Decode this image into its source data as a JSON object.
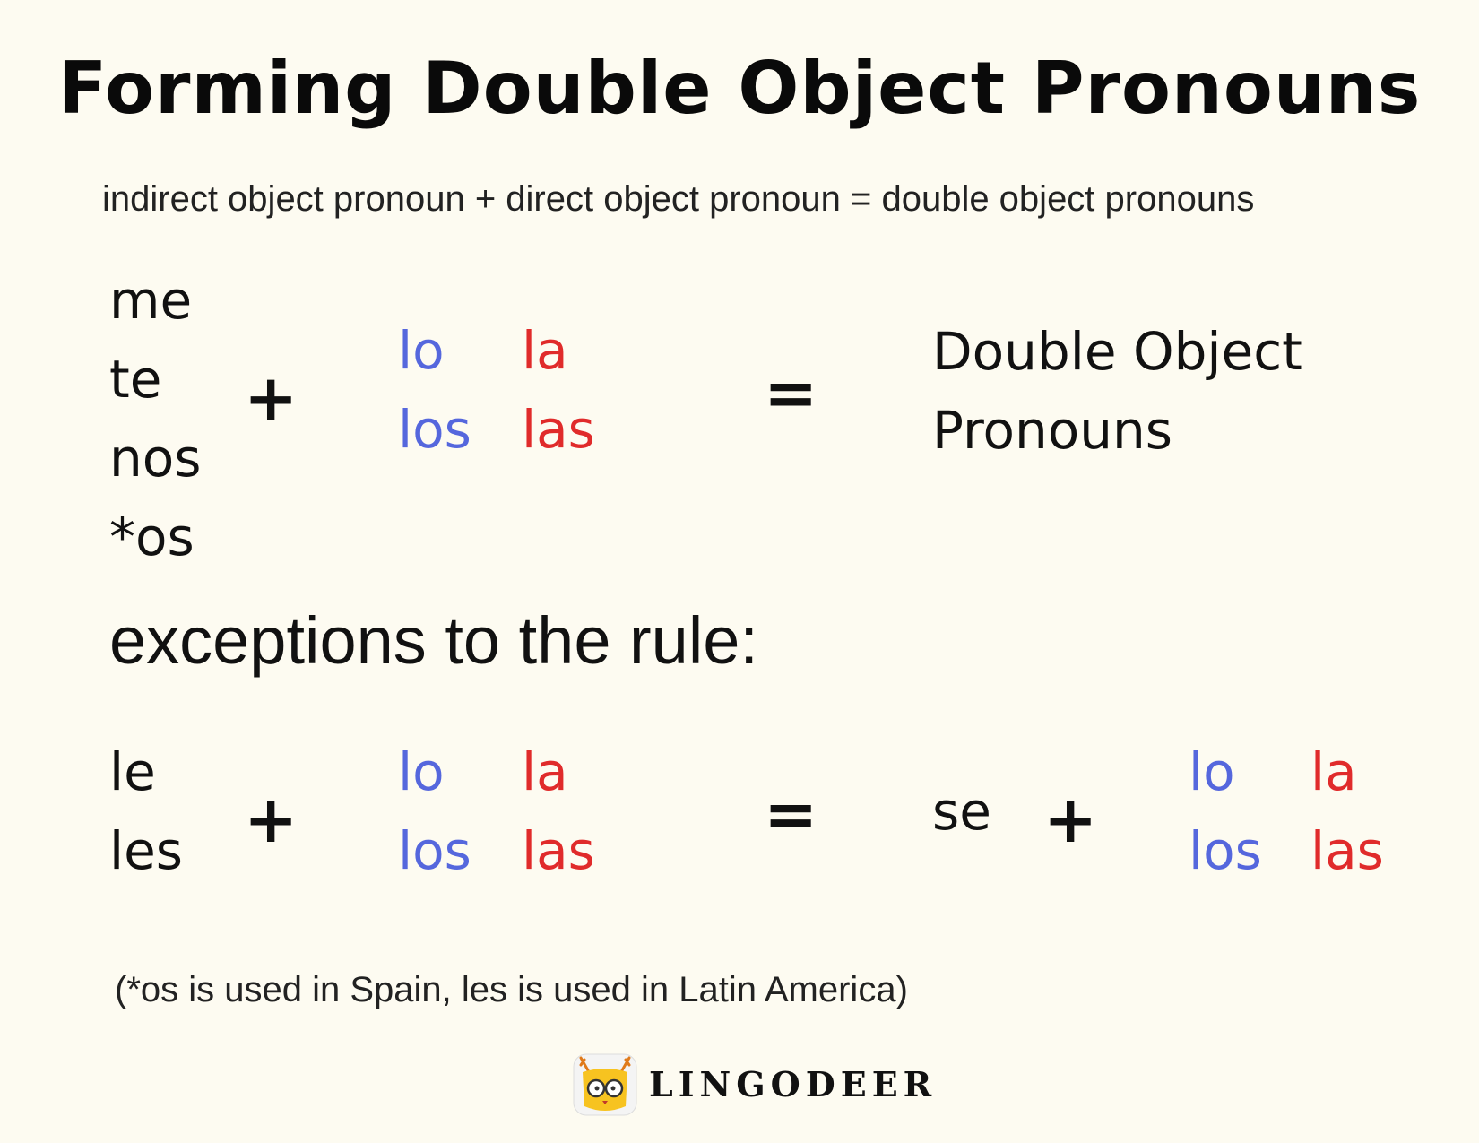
{
  "title": "Forming Double Object Pronouns",
  "formula": "indirect object pronoun + direct object pronoun = double object pronouns",
  "rule": {
    "indirect": [
      "me",
      "te",
      "nos",
      "*os"
    ],
    "plus": "+",
    "direct_masc": [
      "lo",
      "los"
    ],
    "direct_fem": [
      "la",
      "las"
    ],
    "equals": "=",
    "result_lines": [
      "Double Object",
      "Pronouns"
    ]
  },
  "exceptions": {
    "heading": "exceptions to the rule:",
    "indirect": [
      "le",
      "les"
    ],
    "plus": "+",
    "direct_masc": [
      "lo",
      "los"
    ],
    "direct_fem": [
      "la",
      "las"
    ],
    "equals": "=",
    "se": "se",
    "plus2": "+",
    "result_masc": [
      "lo",
      "los"
    ],
    "result_fem": [
      "la",
      "las"
    ]
  },
  "footnote": "(*os is used in Spain, les is used in Latin America)",
  "brand": "LINGODEER",
  "colors": {
    "masculine": "#5567dd",
    "feminine": "#e02b2b",
    "background": "#fdfbf1"
  },
  "icons": {
    "logo": "deer-logo-icon"
  }
}
